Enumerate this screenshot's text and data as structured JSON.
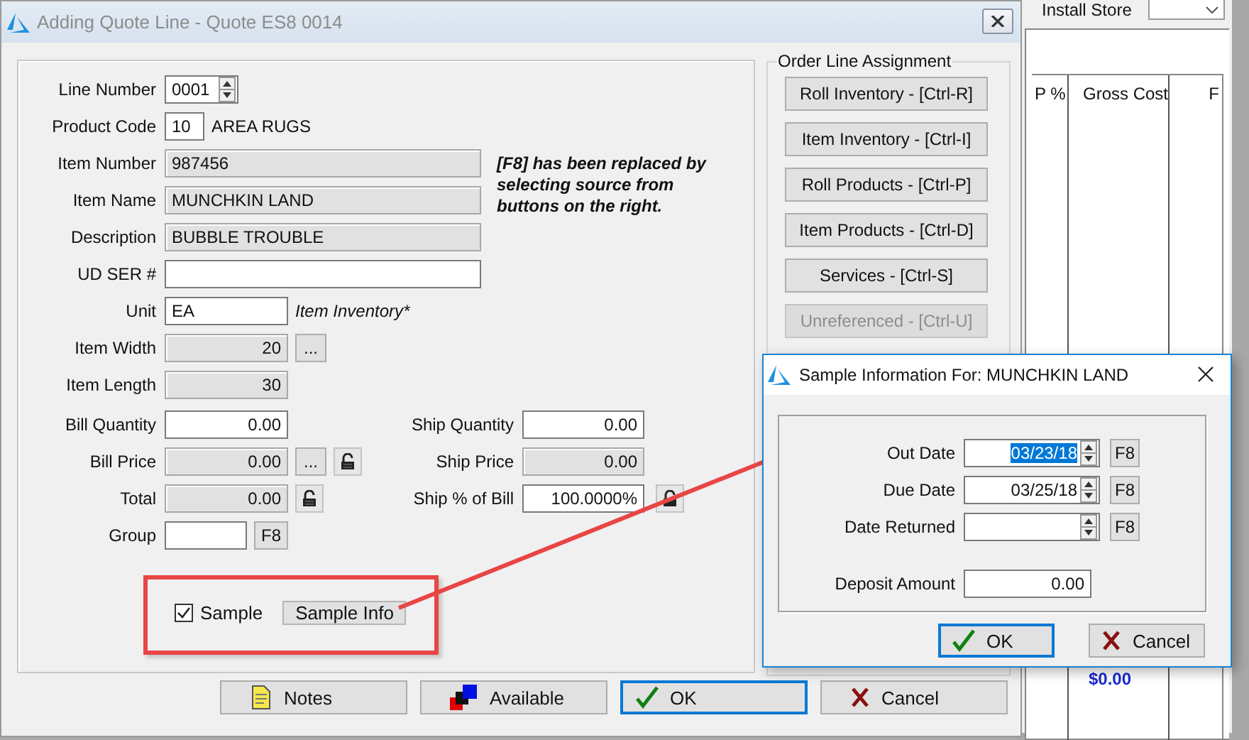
{
  "background_window": {
    "store_label": "Install Store",
    "columns": [
      "P %",
      "Gross Cost",
      "F"
    ],
    "total": "$0.00"
  },
  "dialog": {
    "title": "Adding Quote Line - Quote ES8 0014",
    "active": false,
    "fields": [
      {
        "label": "Line Number",
        "value": "0001",
        "kind": "spin",
        "readonly": false
      },
      {
        "label": "Product Code",
        "value": "10",
        "kind": "code",
        "readonly": false,
        "suffix": "AREA RUGS"
      },
      {
        "label": "Item Number",
        "value": "987456",
        "kind": "text",
        "readonly": true
      },
      {
        "label": "Item Name",
        "value": "MUNCHKIN LAND",
        "kind": "text",
        "readonly": true
      },
      {
        "label": "Description",
        "value": "BUBBLE TROUBLE",
        "kind": "text",
        "readonly": true
      },
      {
        "label": "UD SER #",
        "kind": "text",
        "readonly": false
      },
      {
        "label": "Unit",
        "value": "EA",
        "kind": "short",
        "readonly": false,
        "note": "Item Inventory*"
      },
      {
        "label": "Item Width",
        "value": "20",
        "kind": "number",
        "readonly": true,
        "actions": [
          {
            "kind": "text",
            "label": "..."
          }
        ]
      },
      {
        "label": "Item Length",
        "value": "30",
        "kind": "number",
        "readonly": true
      },
      {
        "label": "Bill Quantity",
        "value": "0.00",
        "kind": "number",
        "readonly": false,
        "paired": {
          "label": "Ship Quantity",
          "value": "0.00",
          "readonly": false
        }
      },
      {
        "label": "Bill Price",
        "value": "0.00",
        "kind": "number",
        "readonly": true,
        "actions": [
          {
            "kind": "text",
            "label": "..."
          },
          {
            "kind": "lock"
          }
        ],
        "paired": {
          "label": "Ship Price",
          "value": "0.00",
          "readonly": true
        }
      },
      {
        "label": "Total",
        "value": "0.00",
        "kind": "number",
        "readonly": true,
        "actions": [
          {
            "kind": "lock"
          }
        ],
        "paired": {
          "label": "Ship % of Bill",
          "value": "100.0000%",
          "readonly": false,
          "actions": [
            {
              "kind": "lock"
            }
          ]
        }
      },
      {
        "label": "Group",
        "kind": "group",
        "readonly": false,
        "actions": [
          {
            "kind": "text",
            "label": "F8"
          }
        ]
      }
    ],
    "note": "[F8] has been replaced by selecting source from buttons on the right.",
    "sample": {
      "label": "Sample",
      "checked": true,
      "button": "Sample Info"
    },
    "assignment": {
      "title": "Order Line Assignment",
      "buttons": [
        {
          "label": "Roll Inventory - [Ctrl-R]",
          "disabled": false
        },
        {
          "label": "Item Inventory - [Ctrl-I]",
          "disabled": false
        },
        {
          "label": "Roll Products - [Ctrl-P]",
          "disabled": false
        },
        {
          "label": "Item Products - [Ctrl-D]",
          "disabled": false
        },
        {
          "label": "Services - [Ctrl-S]",
          "disabled": false
        },
        {
          "label": "Unreferenced - [Ctrl-U]",
          "disabled": true
        }
      ]
    },
    "buttons": [
      {
        "label": "Notes",
        "kind": "notes",
        "focused": false
      },
      {
        "label": "Available",
        "kind": "available",
        "focused": false
      },
      {
        "label": "OK",
        "kind": "ok",
        "focused": true
      },
      {
        "label": "Cancel",
        "kind": "cancel",
        "focused": false
      }
    ]
  },
  "sample_dialog": {
    "title": "Sample Information For: MUNCHKIN LAND",
    "fields": [
      {
        "label": "Out Date",
        "value": "03/23/18",
        "kind": "date",
        "selected": true,
        "action": "F8"
      },
      {
        "label": "Due Date",
        "value": "03/25/18",
        "kind": "date",
        "selected": false,
        "action": "F8"
      },
      {
        "label": "Date Returned",
        "kind": "date",
        "action": "F8"
      },
      {
        "label": "Deposit Amount",
        "value": "0.00",
        "kind": "amount",
        "selected": false
      }
    ],
    "buttons": [
      {
        "label": "OK",
        "kind": "ok",
        "focused": true
      },
      {
        "label": "Cancel",
        "kind": "cancel",
        "focused": false
      }
    ]
  }
}
